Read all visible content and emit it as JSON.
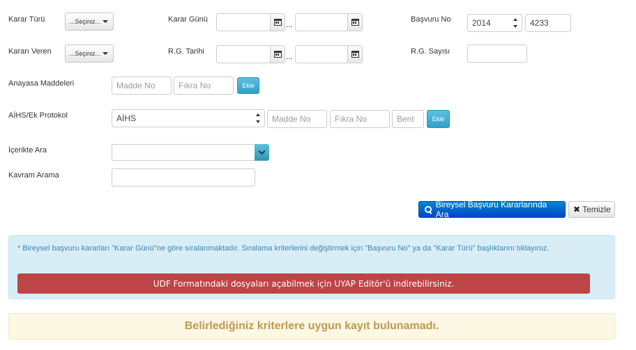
{
  "labels": {
    "karar_turu": "Karar Türü",
    "karar_gunu": "Karar Günü",
    "basvuru_no": "Başvuru No",
    "karari_veren": "Kararı Veren",
    "rg_tarihi": "R.G. Tarihi",
    "rg_sayisi": "R.G. Sayısı",
    "anayasa_maddeleri": "Anayasa Maddeleri",
    "aihs_ek_protokol": "AİHS/Ek Protokol",
    "icerikte_ara": "İçerikte Ara",
    "kavram_arama": "Kavram Arama"
  },
  "selects": {
    "karar_turu": "...Seçiniz...",
    "karari_veren": "...Seçiniz..."
  },
  "date_separator": "...",
  "basvuru": {
    "year": "2014",
    "number": "4233"
  },
  "anayasa": {
    "madde_placeholder": "Madde No",
    "fikra_placeholder": "Fıkra No",
    "add_label": "Ekle"
  },
  "aihs": {
    "selected": "AİHS",
    "madde_placeholder": "Madde No",
    "fikra_placeholder": "Fıkra No",
    "bent_placeholder": "Bent",
    "add_label": "Ekle"
  },
  "actions": {
    "search_label": "Bireysel Başvuru Kararlarında Ara",
    "clear_label": "Temizle"
  },
  "info": {
    "text": "* Bireysel başvuru kararları \"Karar Günü\"ne göre sıralanmaktadır. Sıralama kriterlerini değiştirmek için \"Başvuru No\" ya da \"Karar Türü\" başlıklarını tıklayınız.",
    "banner": "UDF Formatındaki dosyaları açabilmek için UYAP Editör'ü indirebilirsiniz."
  },
  "result": {
    "empty_message": "Belirlediğiniz kriterlere uygun kayıt bulunamadı."
  },
  "colors": {
    "primary": "#0066cc",
    "info_bg": "#d9edf7",
    "danger": "#bd4545",
    "warning_text": "#c09853",
    "addon_blue": "#5bc0de"
  }
}
